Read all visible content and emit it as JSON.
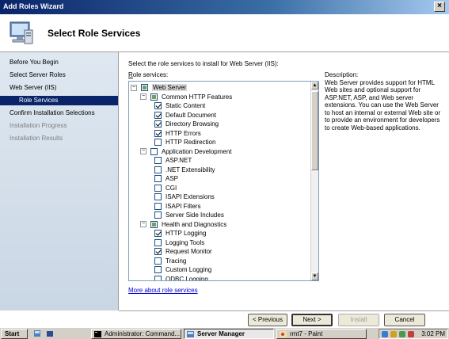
{
  "window": {
    "title": "Add Roles Wizard",
    "close_glyph": "×"
  },
  "header": {
    "title": "Select Role Services",
    "icon": "server-roles-icon"
  },
  "sidebar": {
    "items": [
      {
        "label": "Before You Begin",
        "state": "normal"
      },
      {
        "label": "Select Server Roles",
        "state": "normal"
      },
      {
        "label": "Web Server (IIS)",
        "state": "normal"
      },
      {
        "label": "Role Services",
        "state": "active"
      },
      {
        "label": "Confirm Installation Selections",
        "state": "normal"
      },
      {
        "label": "Installation Progress",
        "state": "disabled"
      },
      {
        "label": "Installation Results",
        "state": "disabled"
      }
    ]
  },
  "main": {
    "instruction": "Select the role services to install for Web Server (IIS):",
    "role_services_label_prefix": "R",
    "role_services_label_rest": "ole services:",
    "tree": [
      {
        "label": "Web Server",
        "level": 0,
        "expander": "−",
        "check": "partial",
        "highlight": true
      },
      {
        "label": "Common HTTP Features",
        "level": 1,
        "expander": "−",
        "check": "partial"
      },
      {
        "label": "Static Content",
        "level": 2,
        "check": "checked"
      },
      {
        "label": "Default Document",
        "level": 2,
        "check": "checked"
      },
      {
        "label": "Directory Browsing",
        "level": 2,
        "check": "checked"
      },
      {
        "label": "HTTP Errors",
        "level": 2,
        "check": "checked"
      },
      {
        "label": "HTTP Redirection",
        "level": 2,
        "check": "unchecked"
      },
      {
        "label": "Application Development",
        "level": 1,
        "expander": "−",
        "check": "unchecked"
      },
      {
        "label": "ASP.NET",
        "level": 2,
        "check": "unchecked"
      },
      {
        "label": ".NET Extensibility",
        "level": 2,
        "check": "unchecked"
      },
      {
        "label": "ASP",
        "level": 2,
        "check": "unchecked"
      },
      {
        "label": "CGI",
        "level": 2,
        "check": "unchecked"
      },
      {
        "label": "ISAPI Extensions",
        "level": 2,
        "check": "unchecked"
      },
      {
        "label": "ISAPI Filters",
        "level": 2,
        "check": "unchecked"
      },
      {
        "label": "Server Side Includes",
        "level": 2,
        "check": "unchecked"
      },
      {
        "label": "Health and Diagnostics",
        "level": 1,
        "expander": "−",
        "check": "partial"
      },
      {
        "label": "HTTP Logging",
        "level": 2,
        "check": "checked"
      },
      {
        "label": "Logging Tools",
        "level": 2,
        "check": "unchecked"
      },
      {
        "label": "Request Monitor",
        "level": 2,
        "check": "checked"
      },
      {
        "label": "Tracing",
        "level": 2,
        "check": "unchecked"
      },
      {
        "label": "Custom Logging",
        "level": 2,
        "check": "unchecked"
      },
      {
        "label": "ODBC Logging",
        "level": 2,
        "check": "unchecked"
      }
    ],
    "description_title": "Description:",
    "description_text": "Web Server provides support for HTML Web sites and optional support for ASP.NET, ASP, and Web server extensions. You can use the Web Server to host an internal or external Web site or to provide an environment for developers to create Web-based applications.",
    "more_link": "More about role services",
    "scroll_up": "▲",
    "scroll_down": "▼"
  },
  "buttons": {
    "previous": "< Previous",
    "next": "Next >",
    "install": "Install",
    "cancel": "Cancel"
  },
  "taskbar": {
    "start": "Start",
    "tasks": [
      {
        "label": "Administrator: Command...",
        "active": false
      },
      {
        "label": "Server Manager",
        "active": true
      },
      {
        "label": "rmt7 - Paint",
        "active": false
      }
    ],
    "clock": "3:02 PM"
  },
  "colors": {
    "title_gradient_start": "#0a246a",
    "sidebar_active": "#0a246a",
    "link": "#0000cc"
  }
}
